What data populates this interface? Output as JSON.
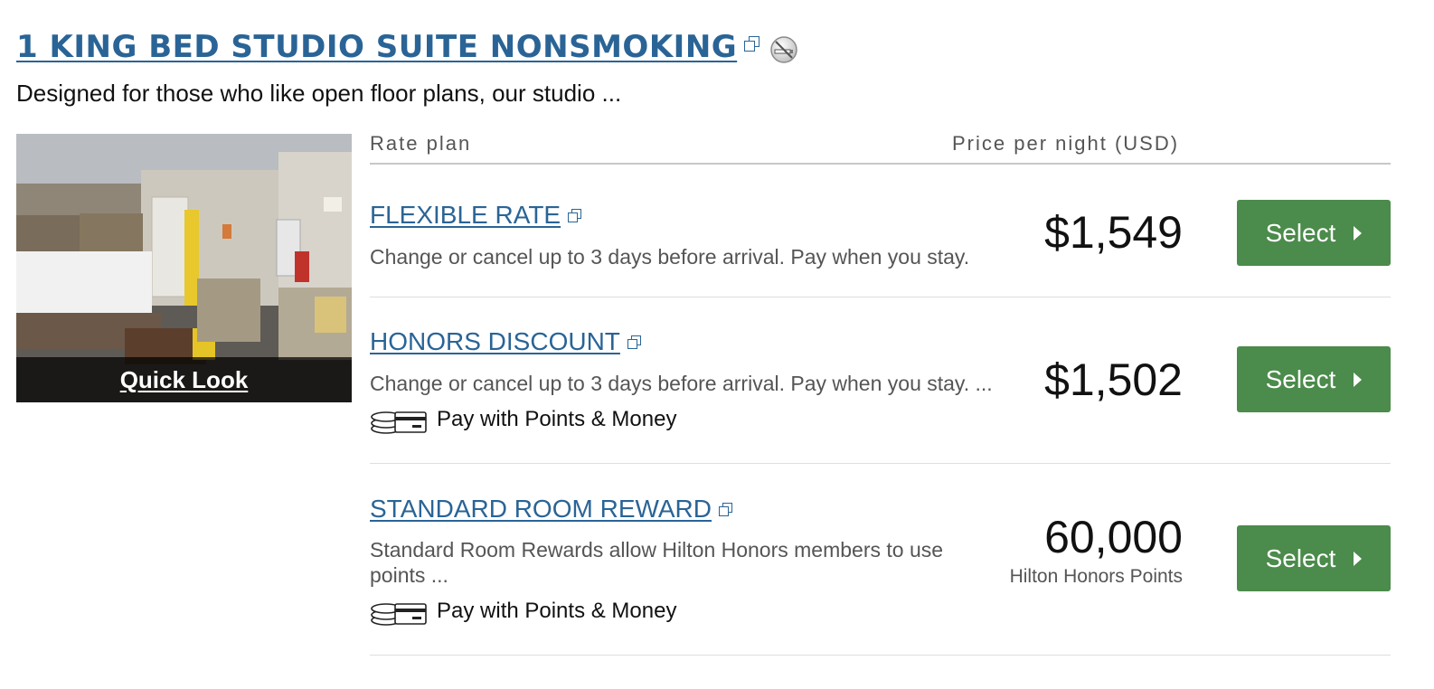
{
  "room": {
    "title": "1 KING BED STUDIO SUITE NONSMOKING",
    "description": "Designed for those who like open floor plans, our studio ...",
    "quick_look": "Quick Look"
  },
  "table_header": {
    "rate_plan": "Rate plan",
    "price_per_night": "Price per night (USD)"
  },
  "rates": [
    {
      "name": "FLEXIBLE RATE",
      "description": "Change or cancel up to 3 days before arrival. Pay when you stay.",
      "price": "$1,549",
      "select_label": "Select"
    },
    {
      "name": "HONORS DISCOUNT",
      "description": "Change or cancel up to 3 days before arrival. Pay when you stay. ...",
      "points_money": "Pay with Points & Money",
      "price": "$1,502",
      "select_label": "Select"
    },
    {
      "name": "STANDARD ROOM REWARD",
      "description": "Standard Room Rewards allow Hilton Honors members to use points ...",
      "points_money": "Pay with Points & Money",
      "price": "60,000",
      "price_sub": "Hilton Honors Points",
      "select_label": "Select"
    }
  ],
  "colors": {
    "link": "#2a6496",
    "select_button": "#4b8b4b",
    "divider": "#dedede"
  },
  "icons": {
    "external_link": "external-link-icon",
    "no_smoking": "no-smoking-icon",
    "points_money": "coins-card-icon",
    "caret": "caret-right-icon"
  }
}
